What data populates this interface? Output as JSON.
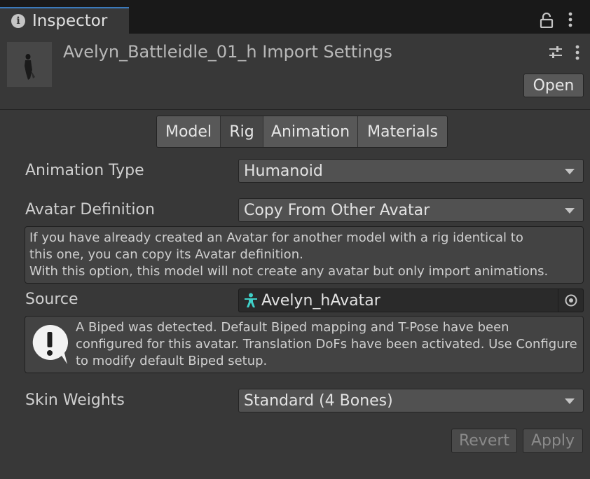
{
  "tab": {
    "title": "Inspector",
    "info_glyph": "i"
  },
  "header": {
    "title": "Avelyn_Battleidle_01_h Import Settings",
    "open_label": "Open"
  },
  "toolbar": {
    "tabs": [
      "Model",
      "Rig",
      "Animation",
      "Materials"
    ],
    "active": "Rig"
  },
  "rig": {
    "animation_type": {
      "label": "Animation Type",
      "value": "Humanoid"
    },
    "avatar_definition": {
      "label": "Avatar Definition",
      "value": "Copy From Other Avatar"
    },
    "info_lines": [
      "If you have already created an Avatar for another model with a rig identical to",
      "this one, you can copy its Avatar definition.",
      "With this option, this model will not create any avatar but only import animations."
    ],
    "source": {
      "label": "Source",
      "value": "Avelyn_hAvatar"
    },
    "warning": "A Biped was detected. Default Biped mapping and T-Pose have been configured for this avatar. Translation DoFs have been activated. Use Configure to modify default Biped setup.",
    "skin_weights": {
      "label": "Skin Weights",
      "value": "Standard (4 Bones)"
    }
  },
  "footer": {
    "revert_label": "Revert",
    "apply_label": "Apply"
  },
  "icons": {
    "info": "info-icon",
    "lock": "lock-icon",
    "menu": "kebab-menu-icon",
    "presets": "presets-sliders-icon",
    "avatar": "humanoid-avatar-icon",
    "picker": "object-picker-icon",
    "warning": "warning-bubble-icon"
  },
  "colors": {
    "background": "#383838",
    "tab_accent": "#3a79bb",
    "avatar_icon": "#3fd0c8"
  }
}
